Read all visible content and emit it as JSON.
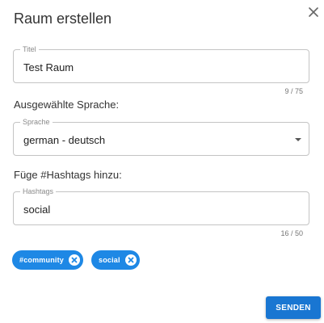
{
  "dialog": {
    "title": "Raum erstellen",
    "close_icon": "close-icon"
  },
  "title_field": {
    "label": "Titel",
    "value": "Test Raum",
    "counter": "9 / 75"
  },
  "language": {
    "section_label": "Ausgewählte Sprache:",
    "field_label": "Sprache",
    "selected": "german - deutsch",
    "dropdown_icon": "caret-down-icon"
  },
  "hashtags": {
    "section_label": "Füge #Hashtags hinzu:",
    "field_label": "Hashtags",
    "value": "social",
    "counter": "16 / 50",
    "chips": [
      {
        "label": "#community",
        "remove_icon": "remove-chip-icon"
      },
      {
        "label": "social",
        "remove_icon": "remove-chip-icon"
      }
    ]
  },
  "actions": {
    "send_label": "SENDEN"
  },
  "colors": {
    "accent": "#1976d2",
    "chip": "#1e88e5",
    "border": "#c4c4c4"
  }
}
